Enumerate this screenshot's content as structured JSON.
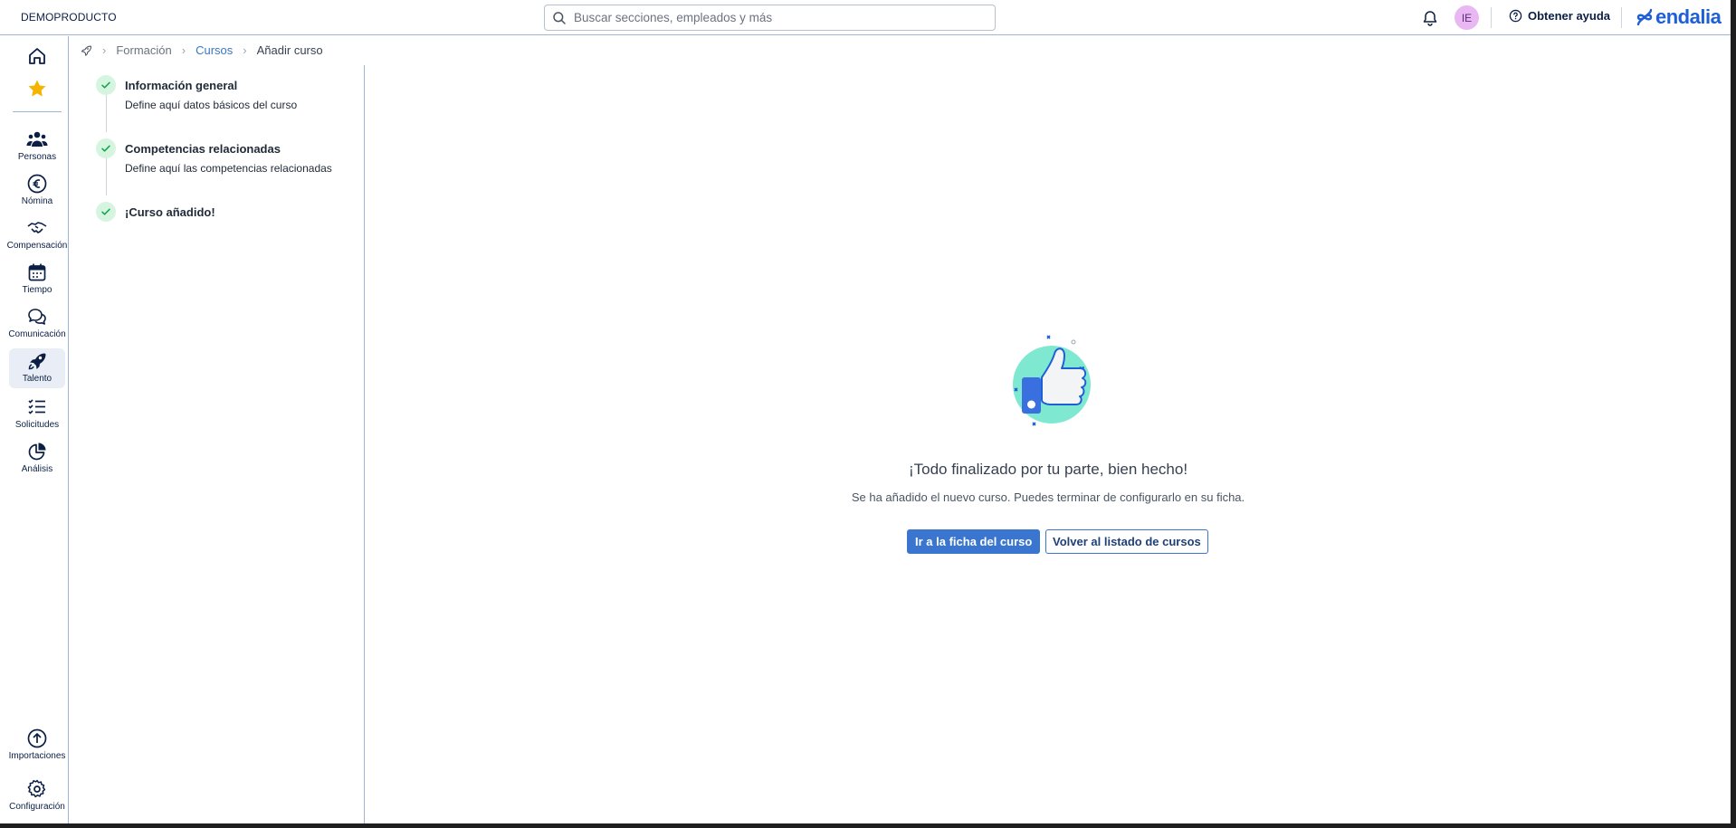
{
  "header": {
    "company": "DEMOPRODUCTO",
    "search_placeholder": "Buscar secciones, empleados y más",
    "avatar_initials": "IE",
    "help_label": "Obtener ayuda",
    "logo_text": "endalia"
  },
  "sidebar": {
    "items": [
      {
        "icon": "home-icon",
        "label": ""
      },
      {
        "icon": "star-icon",
        "label": ""
      },
      {
        "icon": "people-icon",
        "label": "Personas"
      },
      {
        "icon": "euro-icon",
        "label": "Nómina"
      },
      {
        "icon": "handshake-icon",
        "label": "Compensación"
      },
      {
        "icon": "calendar-icon",
        "label": "Tiempo"
      },
      {
        "icon": "chat-icon",
        "label": "Comunicación"
      },
      {
        "icon": "rocket-icon",
        "label": "Talento",
        "active": true
      },
      {
        "icon": "checklist-icon",
        "label": "Solicitudes"
      },
      {
        "icon": "pie-chart-icon",
        "label": "Análisis"
      }
    ],
    "bottom": [
      {
        "icon": "upload-icon",
        "label": "Importaciones"
      },
      {
        "icon": "gear-icon",
        "label": "Configuración"
      }
    ]
  },
  "breadcrumb": {
    "items": [
      "Formación",
      "Cursos",
      "Añadir curso"
    ]
  },
  "steps": [
    {
      "title": "Información general",
      "description": "Define aquí datos básicos del curso"
    },
    {
      "title": "Competencias relacionadas",
      "description": "Define aquí las competencias relacionadas"
    },
    {
      "title": "¡Curso añadido!",
      "description": ""
    }
  ],
  "result": {
    "title": "¡Todo finalizado por tu parte, bien hecho!",
    "description": "Se ha añadido el nuevo curso. Puedes terminar de configurarlo en su ficha.",
    "primary_button": "Ir a la ficha del curso",
    "secondary_button": "Volver al listado de cursos"
  },
  "colors": {
    "accent": "#3a76d0",
    "navy": "#0b1f44",
    "success_bg": "#d6f5e0",
    "avatar_bg": "#e9b7f1"
  }
}
